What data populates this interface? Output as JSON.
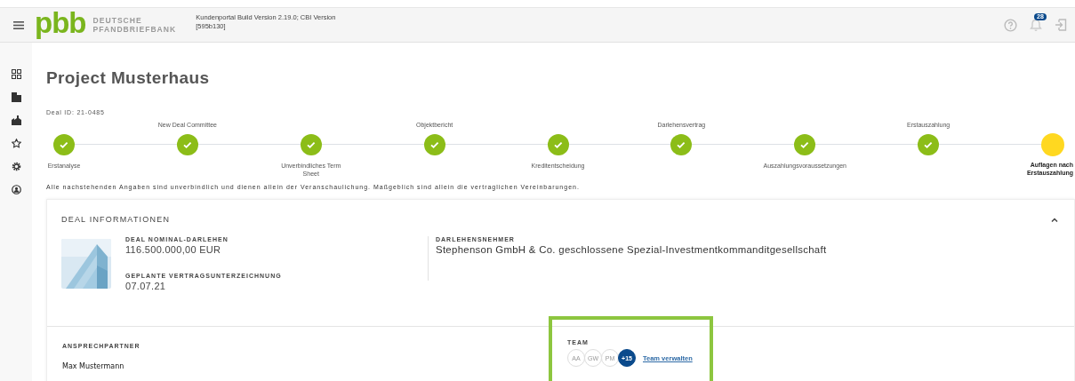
{
  "header": {
    "brand": "pbb",
    "brand_line_1": "DEUTSCHE",
    "brand_line_2": "PFANDBRIEFBANK",
    "build_line_1": "Kundenportal Build Version 2.19.0; CBI Version",
    "build_line_2": "[595b130]",
    "notification_count": "28"
  },
  "sidebar": {
    "items": [
      {
        "selected": false
      },
      {
        "selected": false
      },
      {
        "selected": false
      },
      {
        "selected": false
      },
      {
        "selected": false
      },
      {
        "selected": false
      }
    ]
  },
  "page": {
    "title_bold": "Project",
    "title": "Musterhaus",
    "deal_id": "Deal ID: 21-0485",
    "disclaimer": "Alle nachstehenden Angaben sind unverbindlich und dienen allein der Veranschaulichung. Maßgeblich sind allein die vertraglichen Vereinbarungen."
  },
  "steps": [
    {
      "label": "Erstanalyse",
      "completed": true
    },
    {
      "label": "New Deal Committee",
      "completed": true
    },
    {
      "label": "Unverbindliches Term Sheet",
      "completed": true
    },
    {
      "label": "Objektbericht",
      "completed": true
    },
    {
      "label": "Kreditentscheidung",
      "completed": true
    },
    {
      "label": "Darlehensvertrag",
      "completed": true
    },
    {
      "label": "Auszahlungsvoraussetzungen",
      "completed": true
    },
    {
      "label": "Erstauszahlung",
      "completed": true
    },
    {
      "label": "Auflagen nach Erstauszahlung",
      "completed": false
    }
  ],
  "deal_card": {
    "title": "DEAL INFORMATIONEN",
    "expanded": true,
    "fields": [
      {
        "label": "DEAL NOMINAL-DARLEHEN",
        "value": "116.500.000,00 EUR"
      },
      {
        "label": "GEPLANTE VERTRAGSUNTERZEICHNUNG",
        "value": "07.07.21"
      }
    ],
    "borrower": {
      "label": "DARLEHENSNEHMER",
      "value": "Stephenson GmbH & Co. geschlossene Spezial-Investmentkommanditgesellschaft"
    },
    "contact": {
      "label": "ANSPRECHPARTNER",
      "value": "Max Mustermann"
    },
    "team": {
      "label": "TEAM",
      "members": [
        {
          "initials": "AA",
          "kind": "member"
        },
        {
          "initials": "GW",
          "kind": "member"
        },
        {
          "initials": "PM",
          "kind": "member"
        },
        {
          "initials": "+15",
          "kind": "more"
        }
      ],
      "link": "Team verwalten",
      "highlighted": true
    }
  }
}
